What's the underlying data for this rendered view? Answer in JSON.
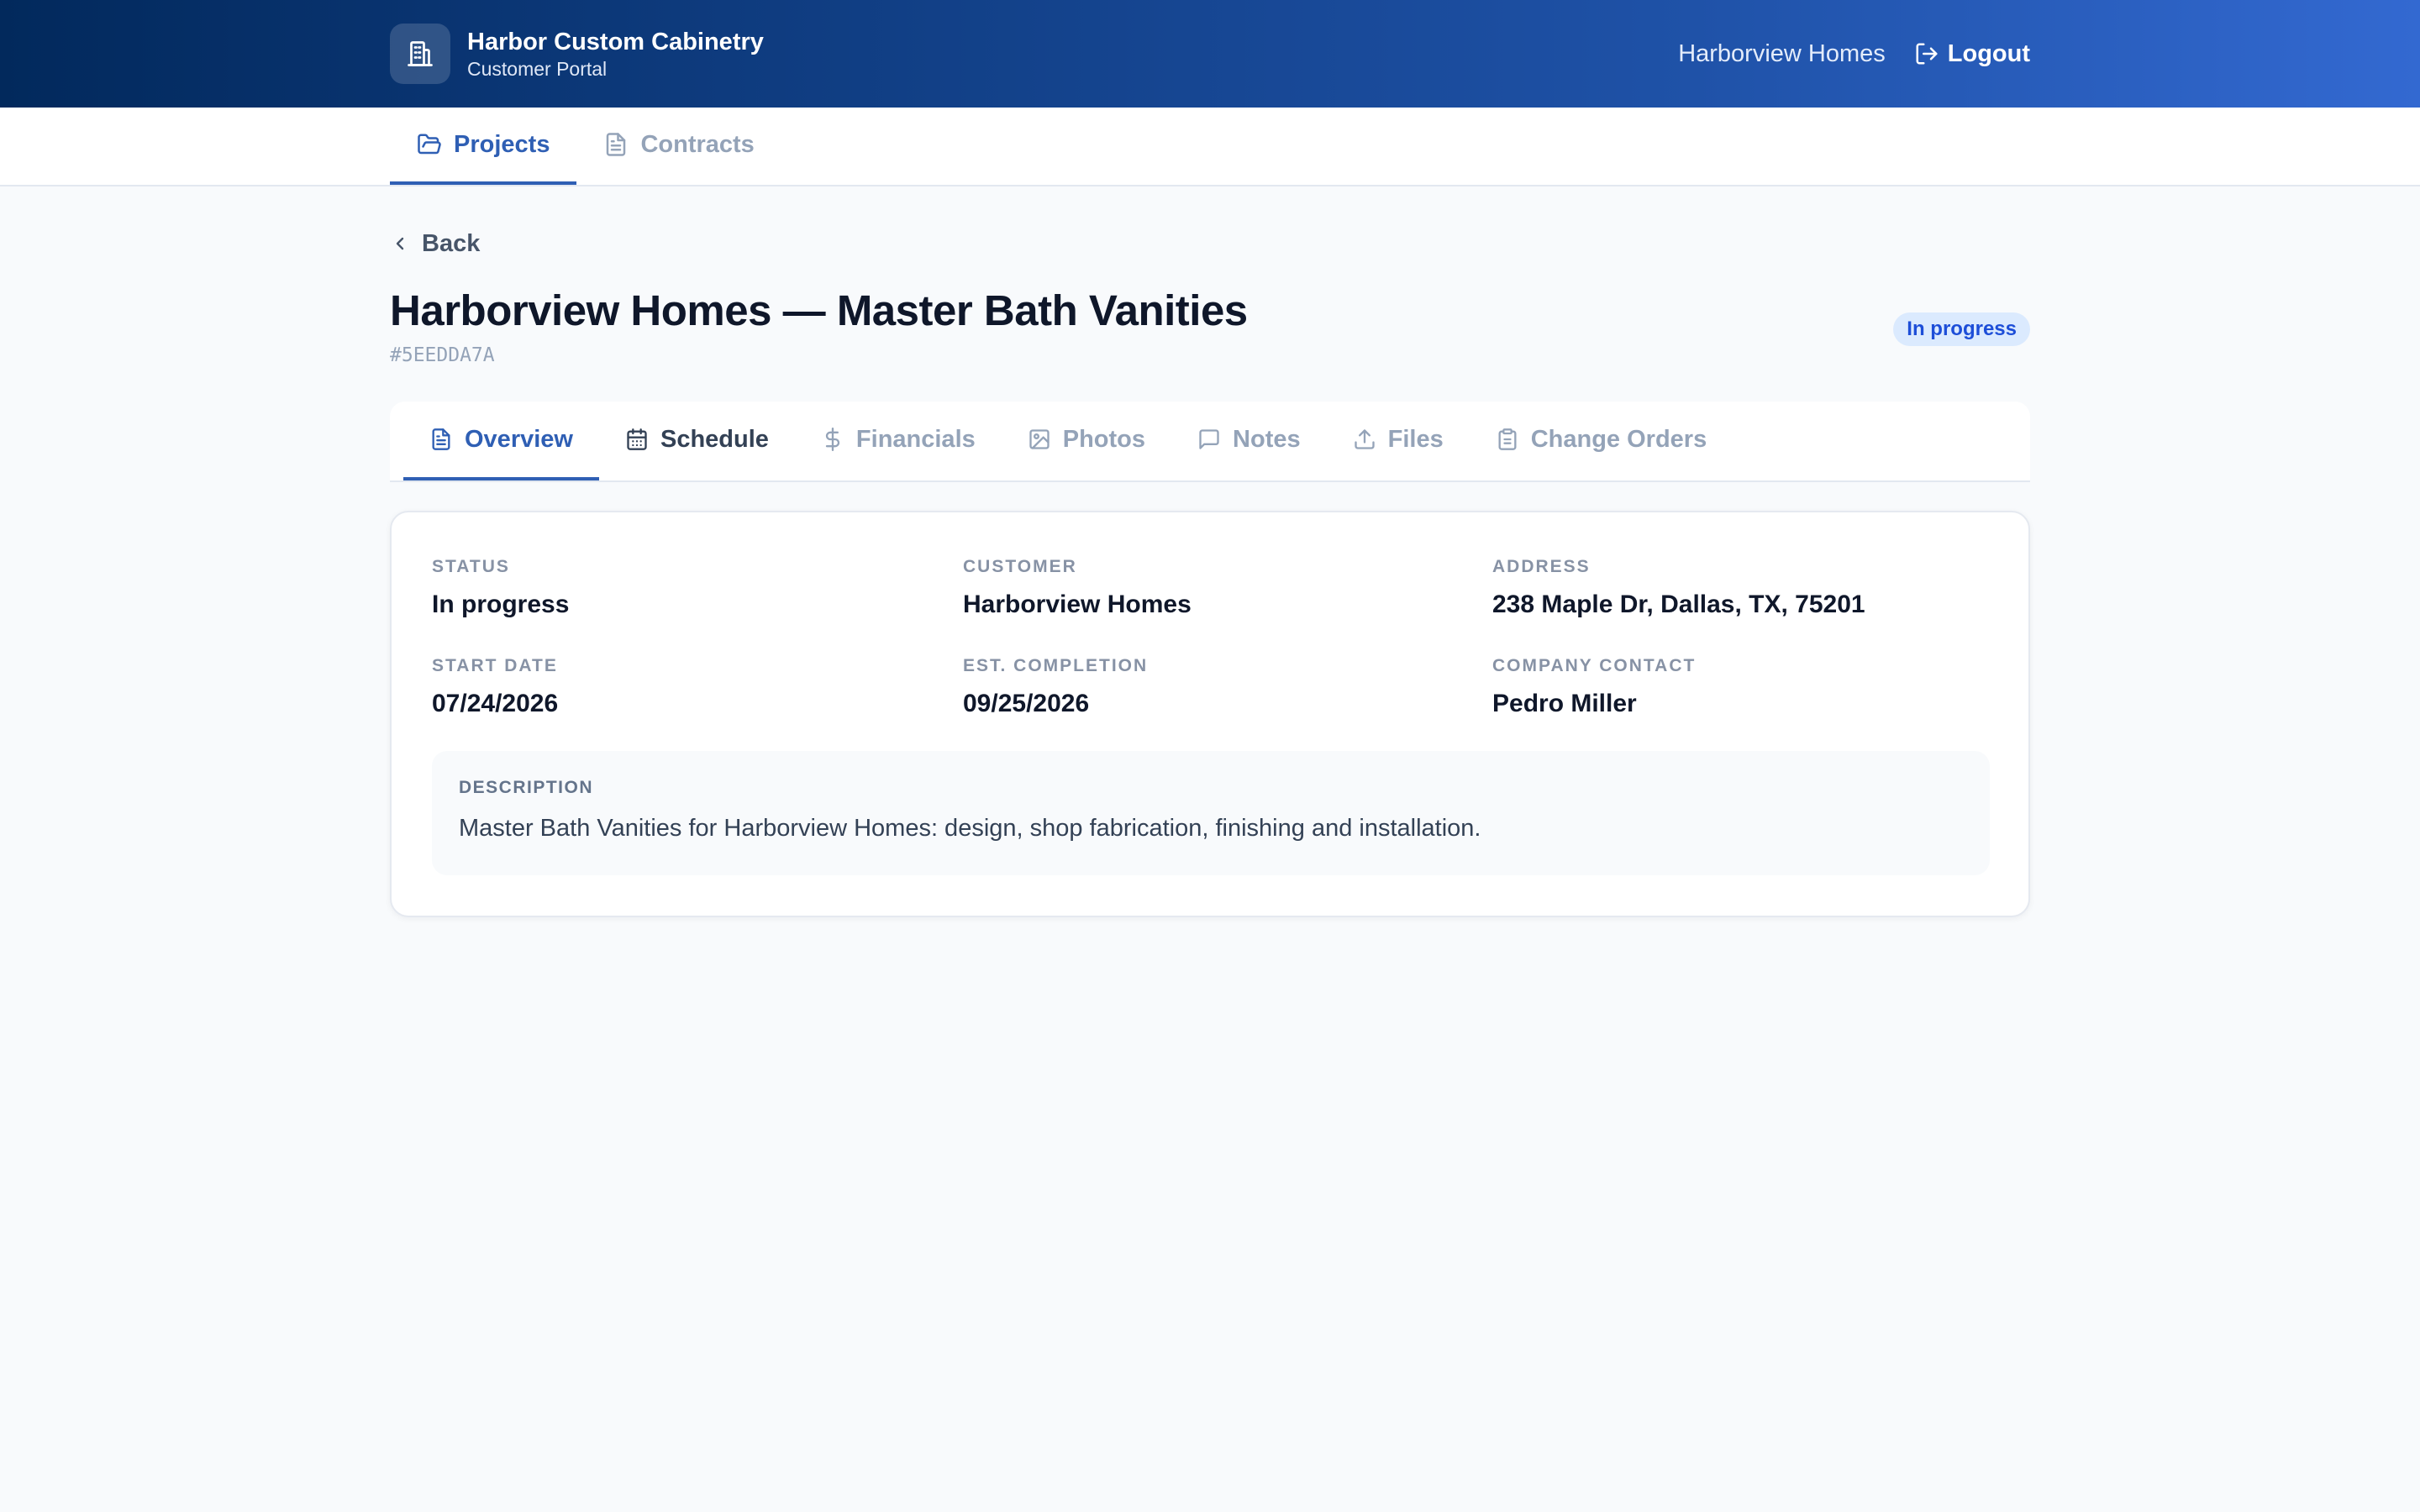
{
  "header": {
    "company_name": "Harbor Custom Cabinetry",
    "portal_name": "Customer Portal",
    "user_name": "Harborview Homes",
    "logout_label": "Logout"
  },
  "main_nav": {
    "tabs": [
      {
        "label": "Projects",
        "icon": "folder-open-icon",
        "active": true
      },
      {
        "label": "Contracts",
        "icon": "document-icon",
        "active": false
      }
    ]
  },
  "page": {
    "back_label": "Back",
    "title": "Harborview Homes — Master Bath Vanities",
    "project_id": "#5EEDDA7A",
    "status_badge": "In progress"
  },
  "sub_tabs": [
    {
      "label": "Overview",
      "icon": "file-text-icon",
      "active": true
    },
    {
      "label": "Schedule",
      "icon": "calendar-icon",
      "active": false
    },
    {
      "label": "Financials",
      "icon": "dollar-icon",
      "active": false
    },
    {
      "label": "Photos",
      "icon": "image-icon",
      "active": false
    },
    {
      "label": "Notes",
      "icon": "message-icon",
      "active": false
    },
    {
      "label": "Files",
      "icon": "upload-icon",
      "active": false
    },
    {
      "label": "Change Orders",
      "icon": "clipboard-icon",
      "active": false
    }
  ],
  "overview": {
    "status": {
      "label": "STATUS",
      "value": "In progress"
    },
    "customer": {
      "label": "CUSTOMER",
      "value": "Harborview Homes"
    },
    "address": {
      "label": "ADDRESS",
      "value": "238 Maple Dr, Dallas, TX, 75201"
    },
    "start_date": {
      "label": "START DATE",
      "value": "07/24/2026"
    },
    "est_completion": {
      "label": "EST. COMPLETION",
      "value": "09/25/2026"
    },
    "company_contact": {
      "label": "COMPANY CONTACT",
      "value": "Pedro Miller"
    },
    "description": {
      "label": "DESCRIPTION",
      "text": "Master Bath Vanities for Harborview Homes: design, shop fabrication, finishing and installation."
    }
  },
  "colors": {
    "header_gradient_start": "#02295c",
    "header_gradient_end": "#3369d1",
    "accent": "#2f5fb4",
    "badge_bg": "#dbeafe",
    "badge_text": "#1d4ed8",
    "page_bg": "#f8fafc"
  }
}
